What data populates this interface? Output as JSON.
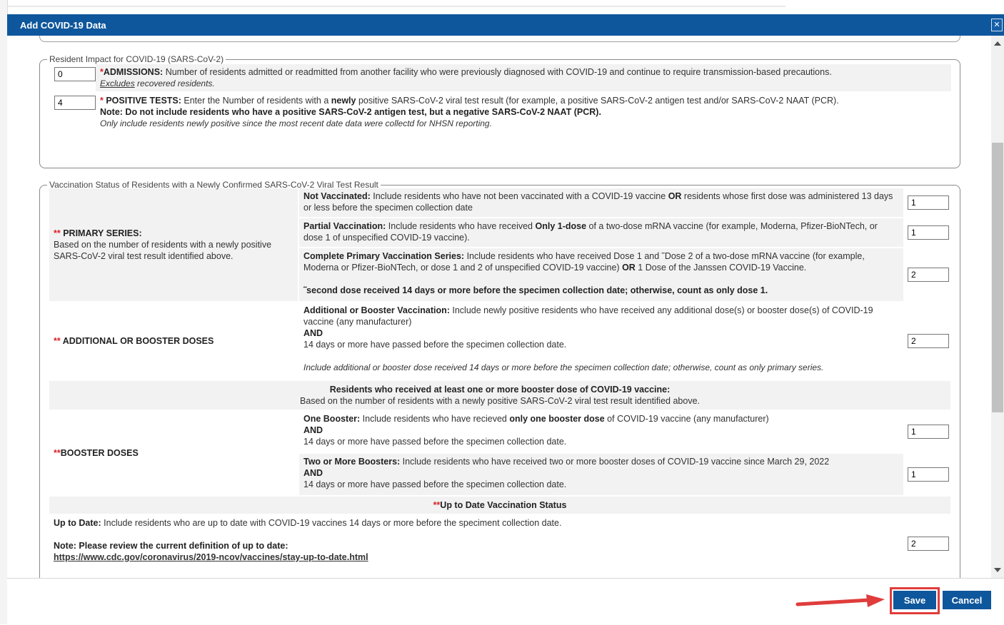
{
  "dialog": {
    "title": "Add COVID-19 Data",
    "close_icon": "close-icon"
  },
  "resident_impact": {
    "legend": "Resident Impact for COVID-19 (SARS-CoV-2)",
    "admissions": {
      "value": "0",
      "star": "*",
      "label": "ADMISSIONS:",
      "text": " Number of residents admitted or readmitted from another facility who were previously diagnosed with COVID-19 and continue to require transmission-based precautions.",
      "excludes": "Excludes",
      "excludes_rest": " recovered residents."
    },
    "positive_tests": {
      "value": "4",
      "star": "*",
      "label": " POSITIVE TESTS:",
      "text_before": " Enter the Number of residents with a ",
      "newly": "newly",
      "text_after": " positive SARS-CoV-2 viral test result (for example, a positive SARS-CoV-2 antigen test and/or SARS-CoV-2 NAAT (PCR).",
      "note": "Note: Do not include residents who have a positive SARS-CoV-2 antigen test, but a negative SARS-CoV-2 NAAT (PCR).",
      "only_include": "Only include residents newly positive since the most recent date data were collectd for NHSN reporting."
    }
  },
  "vaccination": {
    "legend": "Vaccination Status of Residents with a Newly Confirmed SARS-CoV-2 Viral Test Result",
    "primary": {
      "stars": "**",
      "title": " PRIMARY SERIES:",
      "desc": "Based on the number of residents with a newly positive SARS-CoV-2 viral test result identified above.",
      "not_vaccinated": {
        "label": "Not Vaccinated:",
        "text1": " Include residents who have not been vaccinated with a COVID-19 vaccine ",
        "or": "OR",
        "text2": " residents whose first dose was administered 13 days or less before the specimen collection date",
        "value": "1"
      },
      "partial": {
        "label": "Partial Vaccination:",
        "text1": " Include residents who have received ",
        "only": "Only 1-dose",
        "text2": " of a two-dose mRNA vaccine (for example, Moderna, Pfizer-BioNTech, or dose 1 of unspecified COVID-19 vaccine).",
        "value": "1"
      },
      "complete": {
        "label": "Complete Primary Vaccination Series:",
        "text1": " Include residents who have received Dose 1 and ˜Dose 2 of a two-dose mRNA vaccine (for example, Moderna or Pfizer-BioNTech, or dose 1 and 2 of unspecified COVID-19 vaccine) ",
        "or": "OR",
        "text2": " 1 Dose of the Janssen COVID-19 Vaccine.",
        "footnote": "˜second dose received 14 days or more before the specimen collection date; otherwise, count as only dose 1.",
        "value": "2"
      }
    },
    "additional": {
      "stars": "**",
      "title": " ADDITIONAL OR BOOSTER DOSES",
      "label": "Additional or Booster Vaccination:",
      "text": " Include newly positive residents who have received any additional dose(s) or booster dose(s) of COVID-19 vaccine (any manufacturer)",
      "and": "AND",
      "days": "14 days or more have passed before the specimen collection date.",
      "italic": "Include additional or booster dose received 14 days or more before the specimen collection date; otherwise, count as only primary series.",
      "value": "2"
    },
    "booster_header": {
      "title": "Residents who received at least one or more booster dose of COVID-19 vaccine:",
      "sub": "Based on the number of residents with a newly positive SARS-CoV-2 viral test result identified above."
    },
    "booster": {
      "stars": "**",
      "title": "BOOSTER DOSES",
      "one": {
        "label": "One Booster:",
        "text1": " Include residents who have recieved ",
        "only": "only one booster dose",
        "text2": " of COVID-19 vaccine (any manufacturer)",
        "and": "AND",
        "days": "14 days or more have passed before the specimen collection date.",
        "value": "1"
      },
      "two": {
        "label": "Two or More Boosters:",
        "text": " Include residents who have received two or more booster doses of COVID-19 vaccine since March 29, 2022",
        "and": "AND",
        "days": "14 days or more have passed before the specimen collection date.",
        "value": "1"
      }
    },
    "up_to_date_header": {
      "stars": "**",
      "title": "Up to Date Vaccination Status"
    },
    "up_to_date": {
      "label": "Up to Date:",
      "text": " Include residents who are up to date with COVID-19 vaccines 14 days or more before the speciment collection date.",
      "note": "Note: Please review the current definition of up to date:",
      "link": "https://www.cdc.gov/coronavirus/2019-ncov/vaccines/stay-up-to-date.html",
      "value": "2"
    }
  },
  "footer": {
    "save_label": "Save",
    "cancel_label": "Cancel"
  },
  "colors": {
    "primary": "#0f579c",
    "required": "#d9232a",
    "highlight": "#e03c3c"
  }
}
